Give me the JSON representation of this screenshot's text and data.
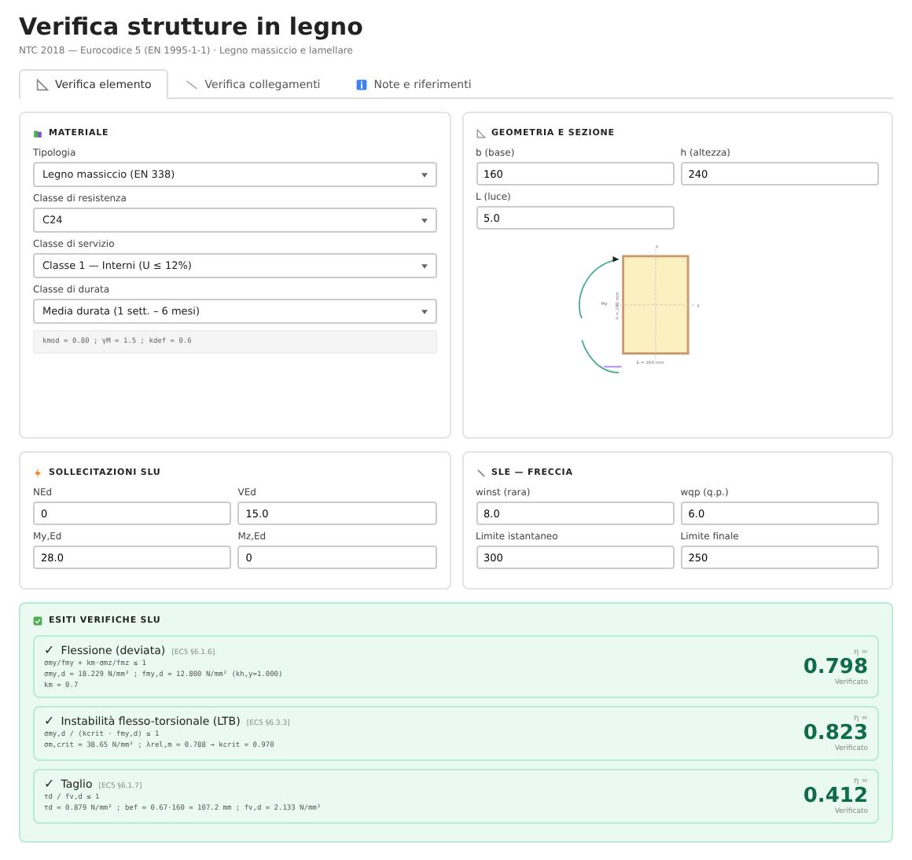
{
  "header": {
    "title": "Verifica strutture in legno",
    "subtitle": "NTC 2018 — Eurocodice 5 (EN 1995-1-1) · Legno massiccio e lamellare"
  },
  "tabs": [
    {
      "label": "Verifica elemento",
      "selected": true
    },
    {
      "label": "Verifica collegamenti",
      "selected": false
    },
    {
      "label": "Note e riferimenti",
      "selected": false
    }
  ],
  "materiale": {
    "title": "MATERIALE",
    "selects": [
      {
        "label": "Tipologia",
        "value": "Legno massiccio (EN 338)"
      },
      {
        "label": "Classe di resistenza",
        "value": "C24"
      },
      {
        "label": "Classe di servizio",
        "value": "Classe 1 — Interni (U ≤ 12%)"
      },
      {
        "label": "Classe di durata",
        "value": "Media durata (1 sett. – 6 mesi)"
      }
    ],
    "note": "kmod = 0.80 ; γM = 1.5 ; kdef = 0.6"
  },
  "geometria": {
    "title": "GEOMETRIA E SEZIONE",
    "fields": [
      {
        "label": "b (base)",
        "value": "160"
      },
      {
        "label": "h (altezza)",
        "value": "240"
      },
      {
        "label": "L (luce)",
        "value": "5.0"
      }
    ],
    "section": {
      "z_top": "z",
      "moment": "My",
      "h_label": "h = 240 mm",
      "y_right": "y",
      "b_label": "b = 160 mm"
    }
  },
  "sollecitazioni": {
    "title": "SOLLECITAZIONI SLU",
    "fields": [
      {
        "label": "NEd",
        "value": "0"
      },
      {
        "label": "VEd",
        "value": "15.0"
      },
      {
        "label": "My,Ed",
        "value": "28.0"
      },
      {
        "label": "Mz,Ed",
        "value": "0"
      }
    ]
  },
  "freccia": {
    "title": "SLE — FRECCIA",
    "fields": [
      {
        "label": "winst (rara)",
        "value": "8.0"
      },
      {
        "label": "wqp (q.p.)",
        "value": "6.0"
      },
      {
        "label": "Limite istantaneo",
        "value": "300"
      },
      {
        "label": "Limite finale",
        "value": "250"
      }
    ]
  },
  "esiti": {
    "title": "ESITI VERIFICHE SLU",
    "checks": [
      {
        "mark": "✓",
        "name": "Flessione (deviata)",
        "ref": "[EC5 §6.1.6]",
        "lines": [
          "σmy/fmy + km·σmz/fmz ≤ 1",
          "σmy,d = 18.229 N/mm² ; fmy,d = 12.800 N/mm² (kh,y=1.000)",
          "km = 0.7"
        ],
        "eta_label": "η =",
        "eta": "0.798",
        "status": "Verificato",
        "passed": true
      },
      {
        "mark": "✓",
        "name": "Instabilità flesso-torsionale (LTB)",
        "ref": "[EC5 §6.3.3]",
        "lines": [
          "σmy,d / (kcrit · fmy,d) ≤ 1",
          "σm,crit = 38.65 N/mm² ; λrel,m = 0.788 → kcrit = 0.970"
        ],
        "eta_label": "η =",
        "eta": "0.823",
        "status": "Verificato",
        "passed": true
      },
      {
        "mark": "✓",
        "name": "Taglio",
        "ref": "[EC5 §6.1.7]",
        "lines": [
          "τd / fv,d ≤ 1",
          "τd = 0.879 N/mm² ; bef = 0.67·160 = 107.2 mm ; fv,d = 2.133 N/mm²"
        ],
        "eta_label": "η =",
        "eta": "0.412",
        "status": "Verificato",
        "passed": true
      }
    ]
  }
}
